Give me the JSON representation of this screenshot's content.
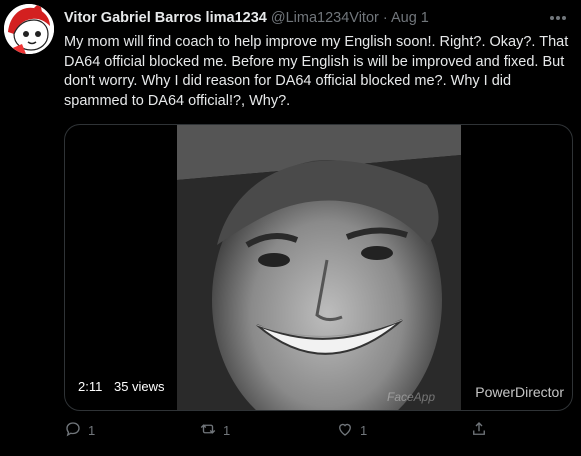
{
  "tweet": {
    "author_name": "Vitor Gabriel Barros lima1234",
    "author_handle": "@Lima1234Vitor",
    "separator": "·",
    "date": "Aug 1",
    "text": "My mom will find coach to help improve my English soon!. Right?. Okay?. That DA64 official blocked me. Before my English is will be improved and fixed. But don't worry. Why I did reason for DA64 official blocked me?. Why I did spammed to DA64 official!?, Why?.",
    "more_icon": "more-icon"
  },
  "media": {
    "duration": "2:11",
    "views": "35 views",
    "watermark": "PowerDirector",
    "watermark_faceapp": "FaceApp"
  },
  "actions": {
    "reply_count": "1",
    "retweet_count": "1",
    "like_count": "1"
  },
  "colors": {
    "background": "#000000",
    "text": "#e7e9ea",
    "secondary": "#71767b",
    "border": "#2f3336"
  }
}
